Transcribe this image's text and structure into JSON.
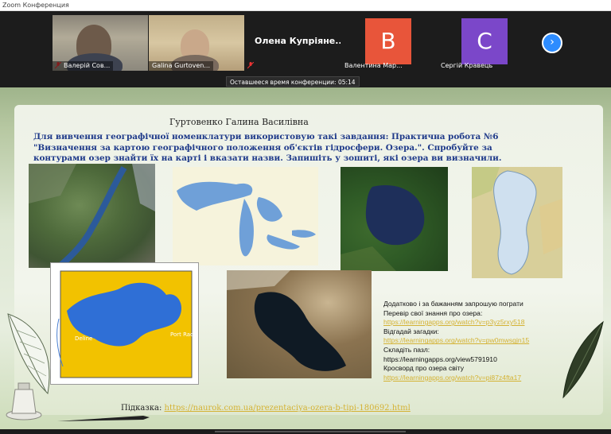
{
  "window": {
    "title": "Zoom Конференция"
  },
  "participants": [
    {
      "name": "Валерій Сов...",
      "type": "video"
    },
    {
      "name": "Galina Gurtoven...",
      "type": "video"
    },
    {
      "name": "Олена  Купріяне...",
      "type": "text"
    },
    {
      "name": "Валентина Мар...",
      "type": "avatar",
      "initial": "В",
      "color": "#e8553a"
    },
    {
      "name": "Сергій Кравець",
      "type": "avatar",
      "initial": "С",
      "color": "#7b47c9"
    }
  ],
  "timer": "Оставшееся время конференции: 05:14",
  "slide": {
    "author": "Гуртовенко Галина Василівна",
    "task": "Для вивчення географічної номенклатури  використовую такі завдання: Практична робота №6 \"Визначення за картою географічного положення об'єктів гідросфери. Озера.\". Спробуйте за контурами озер знайти їх на карті і вказати назви. Запишіть у зошиті, які озера ви визначили.",
    "extra_lines": [
      {
        "text": "Додатково і за бажанням  запрошую пограти",
        "link": false
      },
      {
        "text": "Перевір  свої знання про озера:",
        "link": false
      },
      {
        "text": "https://learningapps.org/watch?v=p3yz5rxy518",
        "link": true
      },
      {
        "text": "Відгадай загадки:",
        "link": false
      },
      {
        "text": "https://learningapps.org/watch?v=pw0mwsgjn15",
        "link": true
      },
      {
        "text": "Складіть пазл:",
        "link": false
      },
      {
        "text": "https://learningapps.org/view5791910",
        "link": false
      },
      {
        "text": "Кросворд про озера світу",
        "link": false
      },
      {
        "text": "https://learningapps.org/watch?v=pi87z4fta17",
        "link": true
      }
    ],
    "hint_label": "Підказка:",
    "hint_link": "https://naurok.com.ua/prezentaciya-ozera-b-tipi-180692.html",
    "map_labels": {
      "deline": "Deline",
      "fort_radium": "Port Radium"
    }
  },
  "colors": {
    "task_text": "#1f3a8a",
    "link": "#d4b234",
    "zoom_blue": "#2d8cff"
  }
}
